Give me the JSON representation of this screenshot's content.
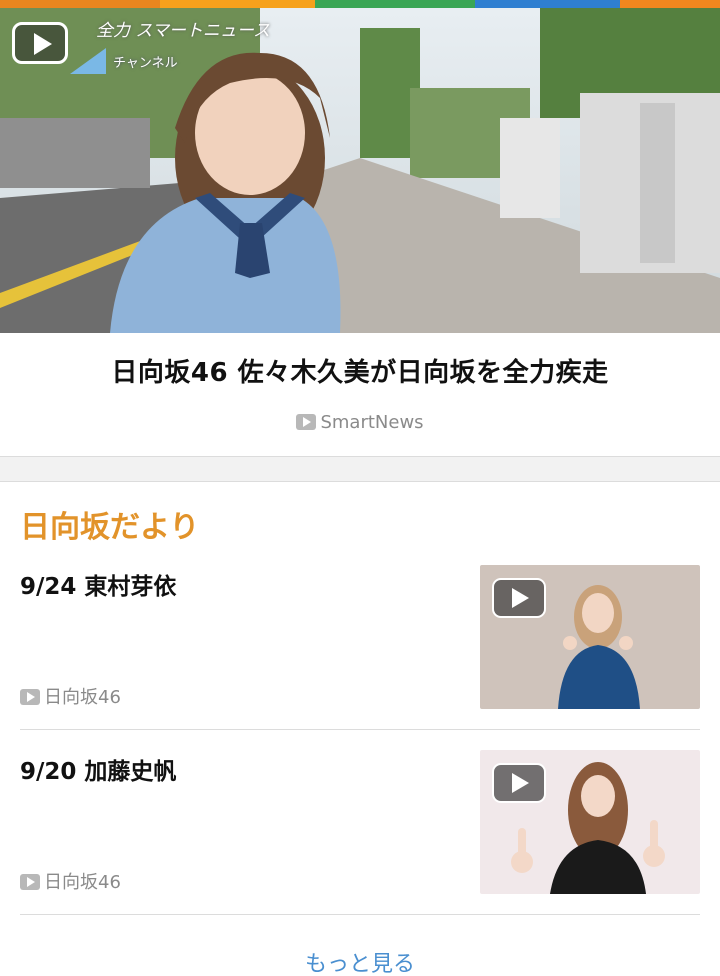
{
  "colors": {
    "accent": "#e2932a",
    "link": "#4a8fd0",
    "topbar": [
      "#e9861f",
      "#f6a11c",
      "#3aa655",
      "#2f7fd1",
      "#f1871e"
    ]
  },
  "hero": {
    "caption": "全力 スマートニュース",
    "channel": "チャンネル",
    "play_icon": "play-icon",
    "headline": "日向坂46 佐々木久美が日向坂を全力疾走",
    "source": "SmartNews"
  },
  "section": {
    "title": "日向坂だより",
    "items": [
      {
        "title": "9/24 東村芽依",
        "source": "日向坂46"
      },
      {
        "title": "9/20 加藤史帆",
        "source": "日向坂46"
      }
    ],
    "more_label": "もっと見る"
  }
}
